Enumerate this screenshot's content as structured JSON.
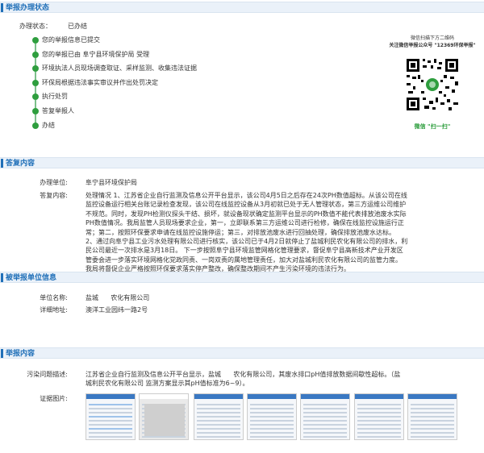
{
  "sections": {
    "status": "举报办理状态",
    "reply": "答复内容",
    "reported": "被举报单位信息",
    "report": "举报内容"
  },
  "status_block": {
    "state_label": "办理状态：",
    "state_value": "已办结",
    "steps": [
      "您的举报信息已提交",
      "您的举报已由 阜宁县环境保护局 受理",
      "环境执法人员现场调查取证、采样监测、收集违法证据",
      "环保局根据违法事实审议并作出处罚决定",
      "执行处罚",
      "答复举报人",
      "办结"
    ]
  },
  "qr": {
    "caption_line1": "微信扫描下方二维码",
    "caption_line2": "关注微信举报公众号 \"12369环保举报\"",
    "caption_bottom": "微信 \"扫一扫\""
  },
  "reply_block": {
    "unit_label": "办理单位:",
    "unit_value": "阜宁县环境保护局",
    "content_label": "答复内容:",
    "content_lines": [
      "处理情况 1、江苏省企业自行监测及信息公开平台显示，该公司4月5日之后存在24次PH数值超标。从该公司在线",
      "监控设备运行相关台账记录检查发现，该公司在线监控设备从3月初就已处于无人管理状态，第三方运维公司维护",
      "不规范。同时，发现PH检测仪探头干结、损坏，就设备现状确定监测平台显示的PH数值不能代表排放池废水实际",
      "PH数值情况。我局监管人员现场要求企业，第一，立即联系第三方运维公司进行检修，确保在线监控设施运行正",
      "常；第二，按照环保要求申请在线监控设施停运；第三，对排放池废水进行回抽处理，确保排放池废水达标。",
      "2、通过向阜宁县工业污水处理有限公司进行核实，该公司已于4月2日就停止了盐城利民农化有限公司的排水，利",
      "民公司最近一次排水是3月18日。  下一步按照阜宁县环境监管网格化管理要求，督促阜宁县高新技术产业开发区",
      "管委会进一步落实环境网格化党政同责、一岗双责的属地管理责任，加大对盐城利民农化有限公司的监管力度。",
      "我局将督促企业严格按照环保要求落实停产整改，确保整改期间不产生污染环境的违法行为。"
    ]
  },
  "reported_block": {
    "name_label": "单位名称:",
    "name_value": "盐城      农化有限公司",
    "address_label": "详细地址:",
    "address_value": "澳洋工业园纬一路2号"
  },
  "report_block": {
    "desc_label": "污染问题描述:",
    "desc_lines": [
      "江苏省企业自行监测及信息公开平台显示，盐城      农化有限公司，其废水排口pH值排放数据间歇性超标。（盐",
      "城利民农化有限公司 监测方案显示其pH值标准为6~9）。"
    ],
    "evidence_label": "证据图片:",
    "thumb_count": 7
  },
  "colors": {
    "accent": "#1f6fb8",
    "step_green": "#2e9e3e",
    "header_bg": "#eaf1f9"
  }
}
